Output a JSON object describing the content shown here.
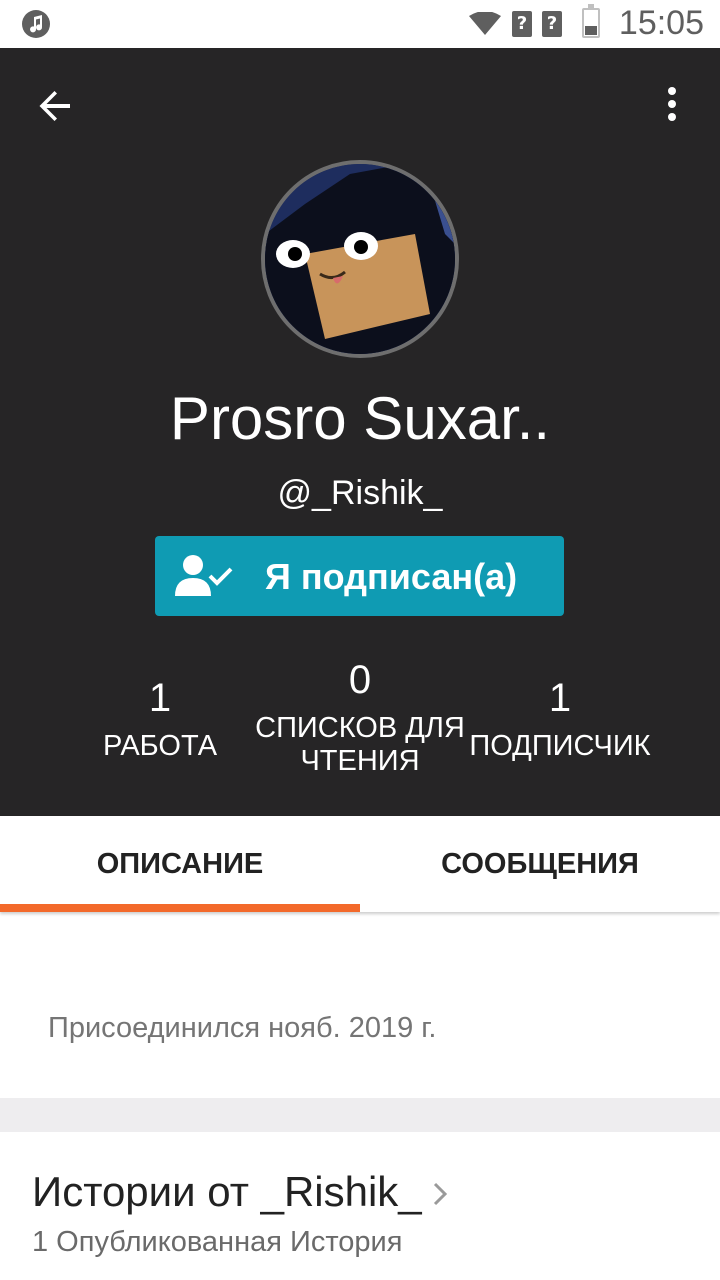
{
  "status_bar": {
    "time": "15:05",
    "icons": [
      "music-icon",
      "wifi-icon",
      "sim-icon",
      "sim-icon",
      "battery-icon"
    ],
    "sim_glyph": "?"
  },
  "header": {
    "display_name": "Prosro Suxar..",
    "username": "@_Rishik_",
    "follow_button_label": "Я подписан(а)",
    "background_color": "#262526",
    "button_color": "#0f9bb3"
  },
  "stats": [
    {
      "value": "1",
      "label": "РАБОТА"
    },
    {
      "value": "0",
      "label": "СПИСКОВ ДЛЯ ЧТЕНИЯ"
    },
    {
      "value": "1",
      "label": "ПОДПИСЧИК"
    }
  ],
  "tabs": [
    {
      "label": "ОПИСАНИЕ",
      "active": true
    },
    {
      "label": "СООБЩЕНИЯ",
      "active": false
    }
  ],
  "accent_color": "#f3692a",
  "about": {
    "joined": "Присоединился нояб. 2019 г."
  },
  "stories": {
    "title": "Истории от _Rishik_",
    "subtitle": "1 Опубликованная История"
  }
}
